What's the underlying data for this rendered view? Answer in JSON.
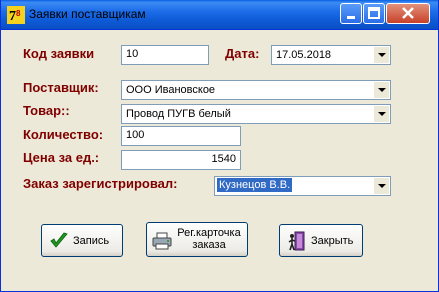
{
  "window": {
    "title": "Заявки поставщикам"
  },
  "form": {
    "request_code_label": "Код заявки",
    "request_code_value": "10",
    "date_label": "Дата:",
    "date_value": "17.05.2018",
    "supplier_label": "Поставщик:",
    "supplier_value": "ООО Ивановское",
    "product_label": "Товар::",
    "product_value": "Провод ПУГВ белый",
    "quantity_label": "Количество:",
    "quantity_value": "100",
    "price_label": "Цена за ед.:",
    "price_value": "1540",
    "registered_by_label": "Заказ зарегистрировал:",
    "registered_by_value": "Кузнецов В.В."
  },
  "buttons": {
    "save_label": "Запись",
    "reg_card_line1": "Рег.карточка",
    "reg_card_line2": "заказа",
    "close_label": "Закрыть"
  },
  "icons": {
    "app": "app-logo-icon",
    "save": "green-checkmark-icon",
    "reg_card": "printer-icon",
    "close": "door-exit-icon"
  },
  "colors": {
    "label_text": "#800000",
    "window_bg": "#ece9d8",
    "titlebar": "#0a5ee0",
    "selection": "#316ac5"
  }
}
